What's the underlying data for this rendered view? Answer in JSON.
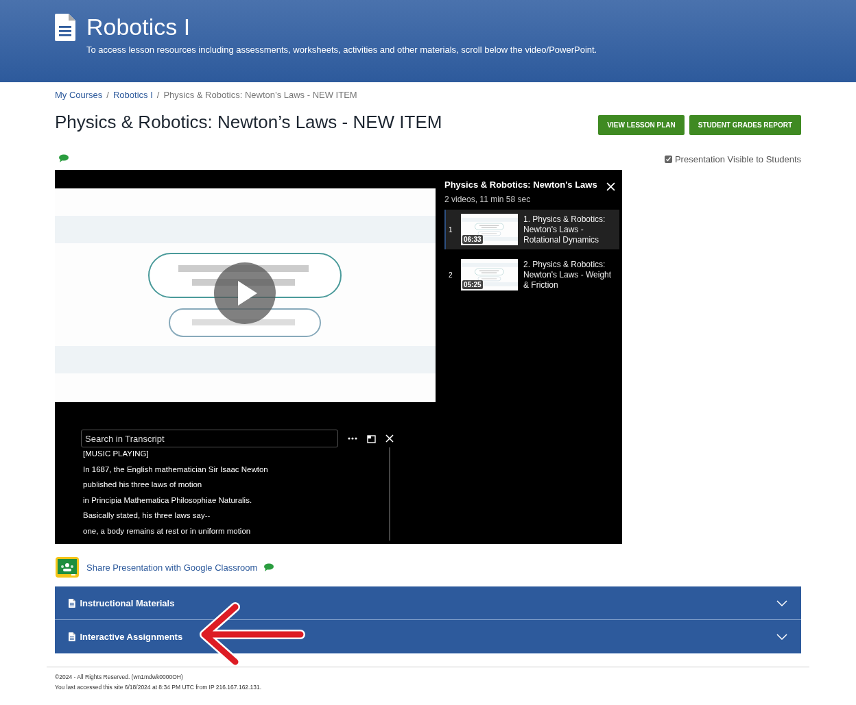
{
  "header": {
    "title": "Robotics I",
    "subtitle": "To access lesson resources including assessments, worksheets, activities and other materials, scroll below the video/PowerPoint."
  },
  "breadcrumbs": [
    {
      "label": "My Courses",
      "kind": "link"
    },
    {
      "separator": "/",
      "label": "Robotics I",
      "kind": "link"
    },
    {
      "separator": "/",
      "label": "Physics & Robotics: Newton’s Laws - NEW ITEM",
      "kind": "current"
    }
  ],
  "page_title": "Physics & Robotics: Newton’s Laws - NEW ITEM",
  "buttons": [
    "VIEW LESSON PLAN",
    "STUDENT GRADES REPORT"
  ],
  "visibility": {
    "label": "Presentation Visible to Students",
    "checked": true
  },
  "player": {
    "playlist": {
      "title": "Physics & Robotics: Newton's Laws",
      "summary": "2 videos, 11 min 58 sec",
      "items": [
        {
          "number": "1",
          "title": "1. Physics & Robotics: Newton's Laws - Rotational Dynamics",
          "duration": "06:33",
          "selected": true
        },
        {
          "number": "2",
          "title": "2. Physics & Robotics: Newton's Laws - Weight & Friction",
          "duration": "05:25",
          "selected": false
        }
      ]
    },
    "transcript": {
      "placeholder": "Search in Transcript",
      "lines": [
        "[MUSIC PLAYING]",
        "In 1687, the English mathematician Sir Isaac Newton",
        "published his three laws of motion",
        "in Principia Mathematica Philosophiae Naturalis.",
        "Basically stated, his three laws say--",
        "one, a body remains at rest or in uniform motion"
      ]
    }
  },
  "share": {
    "label": "Share Presentation with Google Classroom"
  },
  "sections": [
    {
      "title": "Instructional Materials",
      "expanded": false
    },
    {
      "title": "Interactive Assignments",
      "expanded": false
    }
  ],
  "footer": {
    "lines": [
      "©2024 - All Rights Reserved. (wn1mdwk0000OH)",
      "You last accessed this site 6/18/2024 at 8:34 PM UTC from IP 216.167.162.131."
    ]
  }
}
